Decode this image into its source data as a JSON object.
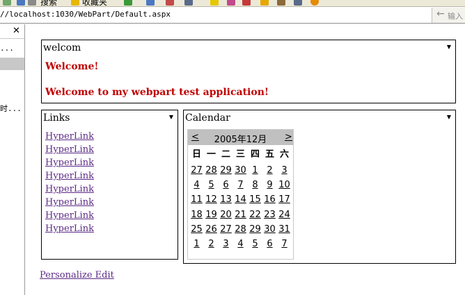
{
  "toolbar": {
    "search_label": "搜索",
    "favorites_label": "收藏夹"
  },
  "address_bar": {
    "url": "//localhost:1030/WebPart/Default.aspx",
    "go_label": "输入"
  },
  "side_pane": {
    "close_label": "✕",
    "text1": "...",
    "text2": "时..."
  },
  "welcome_part": {
    "title": "welcom",
    "menu_icon": "▼",
    "line1": "Welcome!",
    "line2": "Welcome to my webpart test application!"
  },
  "links_part": {
    "title": "Links",
    "menu_icon": "▼",
    "links": [
      "HyperLink",
      "HyperLink",
      "HyperLink",
      "HyperLink",
      "HyperLink",
      "HyperLink",
      "HyperLink",
      "HyperLink"
    ]
  },
  "calendar_part": {
    "title": "Calendar",
    "menu_icon": "▼",
    "prev": "<",
    "next": ">",
    "month_title": "2005年12月",
    "weekdays": [
      "日",
      "一",
      "二",
      "三",
      "四",
      "五",
      "六"
    ],
    "weeks": [
      [
        "27",
        "28",
        "29",
        "30",
        "1",
        "2",
        "3"
      ],
      [
        "4",
        "5",
        "6",
        "7",
        "8",
        "9",
        "10"
      ],
      [
        "11",
        "12",
        "13",
        "14",
        "15",
        "16",
        "17"
      ],
      [
        "18",
        "19",
        "20",
        "21",
        "22",
        "23",
        "24"
      ],
      [
        "25",
        "26",
        "27",
        "28",
        "29",
        "30",
        "31"
      ],
      [
        "1",
        "2",
        "3",
        "4",
        "5",
        "6",
        "7"
      ]
    ]
  },
  "personalize_link": "Personalize Edit",
  "colors": {
    "title_red": "#c00000",
    "link_purple": "#5c2a86",
    "calendar_header": "#c0c0c0"
  }
}
